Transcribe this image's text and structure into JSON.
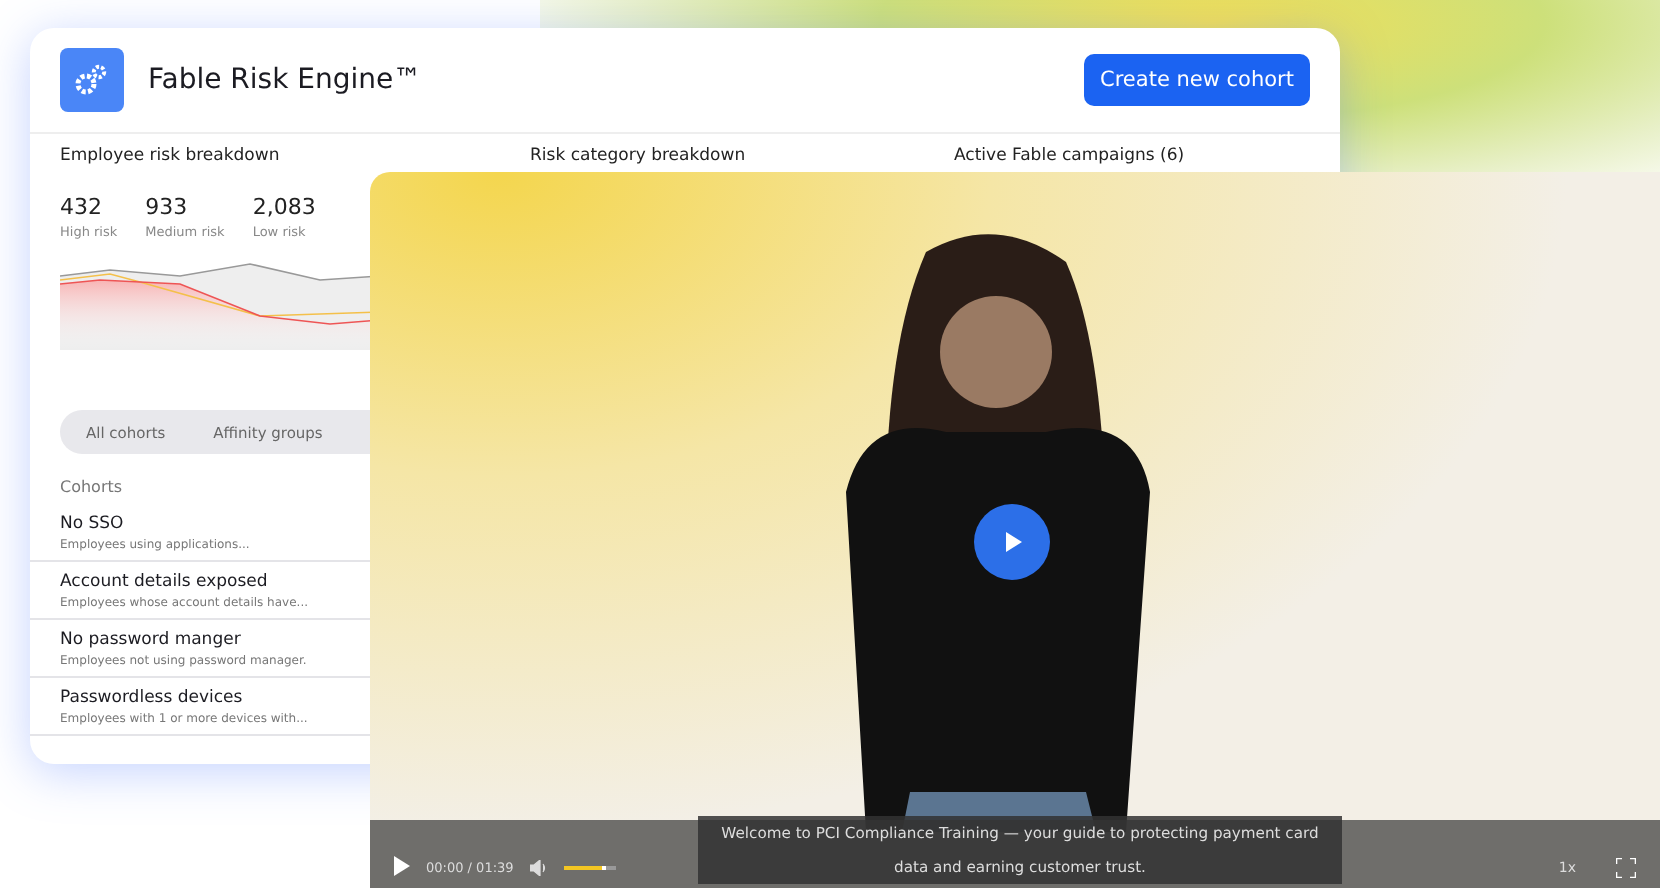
{
  "app": {
    "title": "Fable Risk Engine™",
    "primary_action": "Create new cohort"
  },
  "sections": [
    "Employee risk breakdown",
    "Risk category breakdown",
    "Active Fable campaigns (6)"
  ],
  "risk_stats": [
    {
      "value": "432",
      "label": "High risk"
    },
    {
      "value": "933",
      "label": "Medium risk"
    },
    {
      "value": "2,083",
      "label": "Low risk"
    }
  ],
  "tabs": [
    {
      "label": "All cohorts",
      "selected": false
    },
    {
      "label": "Affinity groups",
      "selected": false
    }
  ],
  "cohorts_heading": "Cohorts",
  "cohorts": [
    {
      "name": "No SSO",
      "description": "Employees using applications..."
    },
    {
      "name": "Account details exposed",
      "description": "Employees whose account details have..."
    },
    {
      "name": "No password manger",
      "description": "Employees not using password manager."
    },
    {
      "name": "Passwordless devices",
      "description": "Employees with 1 or more devices with..."
    }
  ],
  "video": {
    "time": "00:00 / 01:39",
    "volume": {
      "level": 0.8
    },
    "speed": "1x",
    "caption": "Welcome to PCI Compliance Training — your guide to protecting payment card data and earning customer trust."
  }
}
